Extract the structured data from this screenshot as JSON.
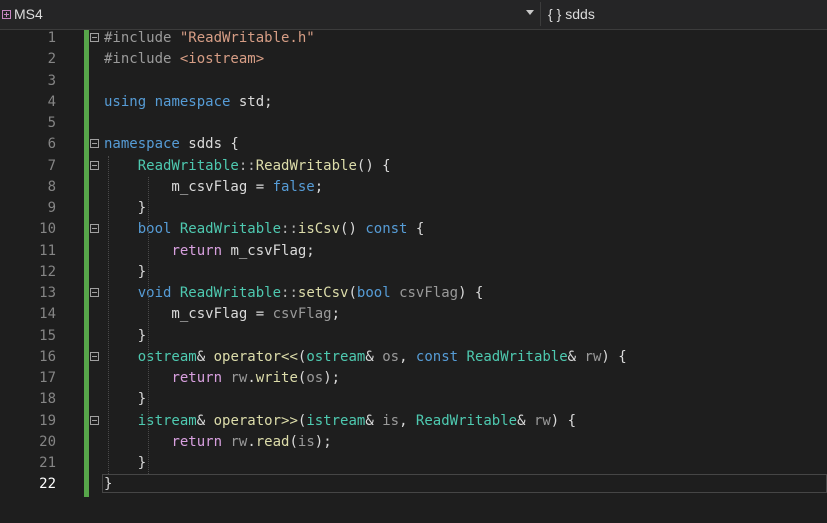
{
  "topbar": {
    "scope": "MS4",
    "member_icon": "{ }",
    "member": "sdds"
  },
  "lines": [
    {
      "n": "1",
      "tokens": [
        [
          "pp",
          "#include "
        ],
        [
          "str",
          "\"ReadWritable.h\""
        ]
      ],
      "fold": true
    },
    {
      "n": "2",
      "tokens": [
        [
          "pp",
          "#include "
        ],
        [
          "str",
          "<iostream>"
        ]
      ]
    },
    {
      "n": "3",
      "tokens": []
    },
    {
      "n": "4",
      "tokens": [
        [
          "kw",
          "using"
        ],
        [
          "var",
          " "
        ],
        [
          "kw",
          "namespace"
        ],
        [
          "var",
          " std;"
        ]
      ]
    },
    {
      "n": "5",
      "tokens": []
    },
    {
      "n": "6",
      "tokens": [
        [
          "kw",
          "namespace"
        ],
        [
          "var",
          " sdds {"
        ]
      ],
      "fold": true
    },
    {
      "n": "7",
      "tokens": [
        [
          "var",
          "    "
        ],
        [
          "type",
          "ReadWritable"
        ],
        [
          "punc",
          "::"
        ],
        [
          "fn",
          "ReadWritable"
        ],
        [
          "var",
          "() {"
        ]
      ],
      "fold": true
    },
    {
      "n": "8",
      "tokens": [
        [
          "var",
          "        m_csvFlag = "
        ],
        [
          "kw",
          "false"
        ],
        [
          "var",
          ";"
        ]
      ]
    },
    {
      "n": "9",
      "tokens": [
        [
          "var",
          "    }"
        ]
      ]
    },
    {
      "n": "10",
      "tokens": [
        [
          "var",
          "    "
        ],
        [
          "kw",
          "bool"
        ],
        [
          "var",
          " "
        ],
        [
          "type",
          "ReadWritable"
        ],
        [
          "punc",
          "::"
        ],
        [
          "fn",
          "isCsv"
        ],
        [
          "var",
          "() "
        ],
        [
          "kw",
          "const"
        ],
        [
          "var",
          " {"
        ]
      ],
      "fold": true
    },
    {
      "n": "11",
      "tokens": [
        [
          "var",
          "        "
        ],
        [
          "kw2",
          "return"
        ],
        [
          "var",
          " m_csvFlag;"
        ]
      ]
    },
    {
      "n": "12",
      "tokens": [
        [
          "var",
          "    }"
        ]
      ]
    },
    {
      "n": "13",
      "tokens": [
        [
          "var",
          "    "
        ],
        [
          "kw",
          "void"
        ],
        [
          "var",
          " "
        ],
        [
          "type",
          "ReadWritable"
        ],
        [
          "punc",
          "::"
        ],
        [
          "fn",
          "setCsv"
        ],
        [
          "var",
          "("
        ],
        [
          "kw",
          "bool"
        ],
        [
          "var",
          " "
        ],
        [
          "param",
          "csvFlag"
        ],
        [
          "var",
          ") {"
        ]
      ],
      "fold": true
    },
    {
      "n": "14",
      "tokens": [
        [
          "var",
          "        m_csvFlag = "
        ],
        [
          "param",
          "csvFlag"
        ],
        [
          "var",
          ";"
        ]
      ]
    },
    {
      "n": "15",
      "tokens": [
        [
          "var",
          "    }"
        ]
      ]
    },
    {
      "n": "16",
      "tokens": [
        [
          "var",
          "    "
        ],
        [
          "type",
          "ostream"
        ],
        [
          "var",
          "& "
        ],
        [
          "fn",
          "operator<<"
        ],
        [
          "var",
          "("
        ],
        [
          "type",
          "ostream"
        ],
        [
          "var",
          "& "
        ],
        [
          "param",
          "os"
        ],
        [
          "var",
          ", "
        ],
        [
          "kw",
          "const"
        ],
        [
          "var",
          " "
        ],
        [
          "type",
          "ReadWritable"
        ],
        [
          "var",
          "& "
        ],
        [
          "param",
          "rw"
        ],
        [
          "var",
          ") {"
        ]
      ],
      "fold": true
    },
    {
      "n": "17",
      "tokens": [
        [
          "var",
          "        "
        ],
        [
          "kw2",
          "return"
        ],
        [
          "var",
          " "
        ],
        [
          "param",
          "rw"
        ],
        [
          "var",
          "."
        ],
        [
          "fn",
          "write"
        ],
        [
          "var",
          "("
        ],
        [
          "param",
          "os"
        ],
        [
          "var",
          ");"
        ]
      ]
    },
    {
      "n": "18",
      "tokens": [
        [
          "var",
          "    }"
        ]
      ]
    },
    {
      "n": "19",
      "tokens": [
        [
          "var",
          "    "
        ],
        [
          "type",
          "istream"
        ],
        [
          "var",
          "& "
        ],
        [
          "fn",
          "operator>>"
        ],
        [
          "var",
          "("
        ],
        [
          "type",
          "istream"
        ],
        [
          "var",
          "& "
        ],
        [
          "param",
          "is"
        ],
        [
          "var",
          ", "
        ],
        [
          "type",
          "ReadWritable"
        ],
        [
          "var",
          "& "
        ],
        [
          "param",
          "rw"
        ],
        [
          "var",
          ") {"
        ]
      ],
      "fold": true
    },
    {
      "n": "20",
      "tokens": [
        [
          "var",
          "        "
        ],
        [
          "kw2",
          "return"
        ],
        [
          "var",
          " "
        ],
        [
          "param",
          "rw"
        ],
        [
          "var",
          "."
        ],
        [
          "fn",
          "read"
        ],
        [
          "var",
          "("
        ],
        [
          "param",
          "is"
        ],
        [
          "var",
          ");"
        ]
      ]
    },
    {
      "n": "21",
      "tokens": [
        [
          "var",
          "    }"
        ]
      ]
    },
    {
      "n": "22",
      "tokens": [
        [
          "var",
          "}"
        ]
      ],
      "current": true
    }
  ]
}
